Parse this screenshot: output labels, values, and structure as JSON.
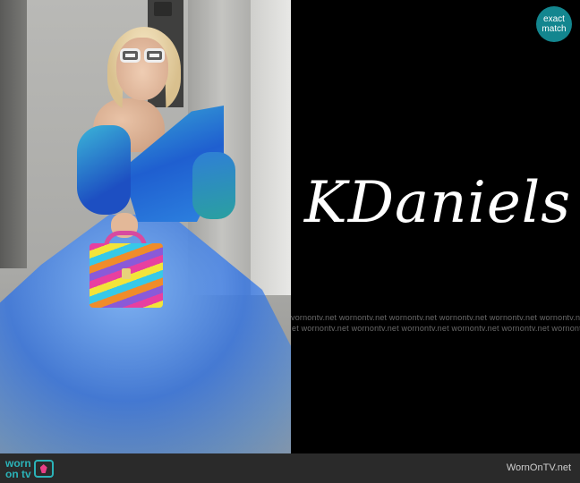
{
  "badge": {
    "line1": "exact",
    "line2": "match"
  },
  "brand": {
    "name": "KDaniels"
  },
  "watermark": {
    "row1": "vornontv.net  wornontv.net  wornontv.net  wornontv.net  wornontv.net  wornontv.net",
    "row2": "et  wornontv.net  wornontv.net  wornontv.net  wornontv.net  wornontv.net  wornontv.net"
  },
  "footer": {
    "logo_worn": "worn",
    "logo_on_tv": "on tv",
    "site": "WornOnTV.net"
  },
  "colors": {
    "badge_bg": "#13868f",
    "logo_teal": "#2bb3b8",
    "footer_bg": "#2a2a2a",
    "right_panel_bg": "#000000"
  }
}
